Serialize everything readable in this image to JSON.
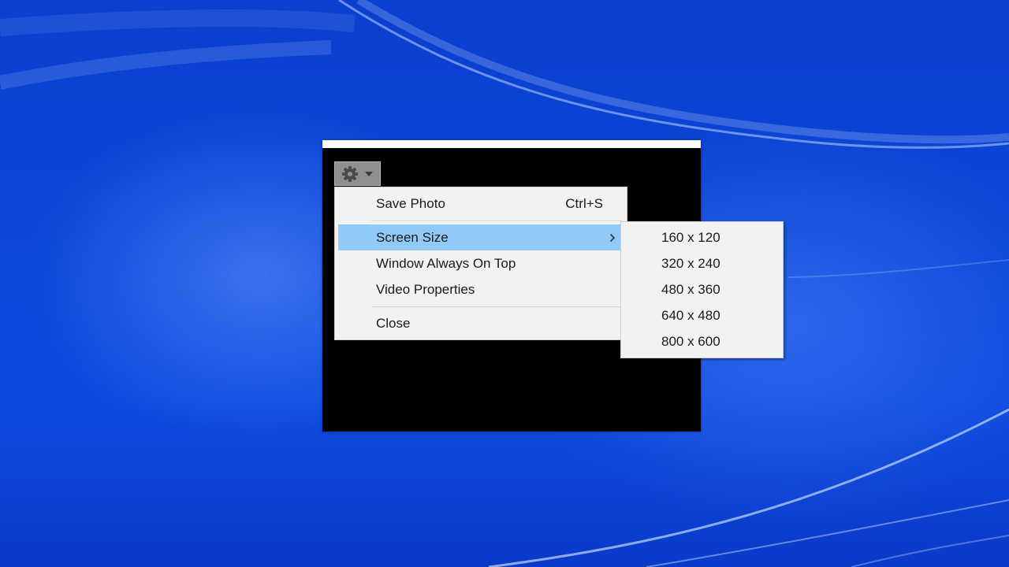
{
  "desktop": {
    "background_color": "#0b47d8"
  },
  "camera_window": {
    "background_color": "#000000"
  },
  "toolbar": {
    "settings_icon": "gear-icon",
    "dropdown_icon": "chevron-down-icon"
  },
  "context_menu": {
    "items": [
      {
        "label": "Save Photo",
        "shortcut": "Ctrl+S"
      },
      {
        "label": "Screen Size",
        "has_submenu": true,
        "highlighted": true
      },
      {
        "label": "Window Always On Top"
      },
      {
        "label": "Video Properties"
      },
      {
        "label": "Close"
      }
    ],
    "highlight_color": "#91c9f7"
  },
  "screen_size_submenu": {
    "items": [
      {
        "label": "160 x 120"
      },
      {
        "label": "320 x 240"
      },
      {
        "label": "480 x 360"
      },
      {
        "label": "640 x 480"
      },
      {
        "label": "800 x 600"
      }
    ]
  }
}
